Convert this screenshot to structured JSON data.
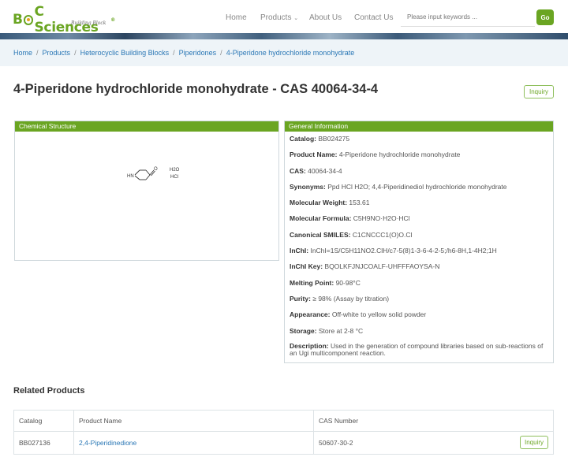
{
  "header": {
    "logo_text_1": "B",
    "logo_text_2": "C Sciences",
    "logo_reg": "®",
    "logo_sub": "Building Block",
    "nav": {
      "home": "Home",
      "products": "Products",
      "about": "About Us",
      "contact": "Contact Us"
    },
    "search_placeholder": "Please input keywords ...",
    "go_label": "Go"
  },
  "breadcrumb": [
    "Home",
    "Products",
    "Heterocyclic Building Blocks",
    "Piperidones",
    "4-Piperidone hydrochloride monohydrate"
  ],
  "page": {
    "title": "4-Piperidone hydrochloride monohydrate - CAS 40064-34-4",
    "inquiry_label": "Inquiry"
  },
  "structure_panel": {
    "heading": "Chemical Structure",
    "labels": {
      "nh": "HN",
      "o": "O",
      "water": "H2O",
      "hcl": "HCl"
    }
  },
  "info_panel": {
    "heading": "General Information",
    "rows": [
      {
        "label": "Catalog:",
        "value": "BB024275"
      },
      {
        "label": "Product Name:",
        "value": "4-Piperidone hydrochloride monohydrate"
      },
      {
        "label": "CAS:",
        "value": "40064-34-4"
      },
      {
        "label": "Synonyms:",
        "value": "Ppd HCl H2O; 4,4-Piperidinediol hydrochloride monohydrate"
      },
      {
        "label": "Molecular Weight:",
        "value": "153.61"
      },
      {
        "label": "Molecular Formula:",
        "value": "C5H9NO·H2O·HCl"
      },
      {
        "label": "Canonical SMILES:",
        "value": "C1CNCCC1(O)O.Cl"
      },
      {
        "label": "InChI:",
        "value": "InChI=1S/C5H11NO2.ClH/c7-5(8)1-3-6-4-2-5;/h6-8H,1-4H2;1H"
      },
      {
        "label": "InChI Key:",
        "value": "BQOLKFJNJCOALF-UHFFFAOYSA-N"
      },
      {
        "label": "Melting Point:",
        "value": "90-98°C"
      },
      {
        "label": "Purity:",
        "value": "≥ 98% (Assay by titration)"
      },
      {
        "label": "Appearance:",
        "value": "Off-white to yellow solid powder"
      },
      {
        "label": "Storage:",
        "value": "Store at 2-8 °C"
      },
      {
        "label": "Description:",
        "value": "Used in the generation of compound libraries based on sub-reactions of an Ugi multicomponent reaction."
      }
    ]
  },
  "related": {
    "title": "Related Products",
    "columns": [
      "Catalog",
      "Product Name",
      "CAS Number"
    ],
    "rows": [
      {
        "catalog": "BB027136",
        "name": "2,4-Piperidinedione",
        "cas": "50607-30-2",
        "inquiry": "Inquiry"
      }
    ]
  },
  "colors": {
    "brand_green": "#6aa522",
    "link_blue": "#2a77b5",
    "breadcrumb_bg": "#eef4f8"
  }
}
